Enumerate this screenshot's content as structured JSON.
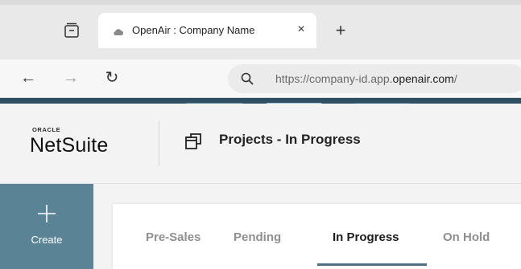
{
  "browser": {
    "tab": {
      "title": "OpenAir : Company Name",
      "close_glyph": "×",
      "favicon": "cloud-icon"
    },
    "new_tab_glyph": "+",
    "nav": {
      "back_glyph": "←",
      "forward_glyph": "→",
      "reload_glyph": "↻"
    },
    "url": {
      "prefix": "https://company-id.app.",
      "domain": "openair.com",
      "suffix": "/"
    }
  },
  "app": {
    "brand": {
      "oracle": "ORACLE",
      "name": "NetSuite"
    },
    "page_title": "Projects - In Progress",
    "create_label": "Create",
    "status_tabs": [
      {
        "label": "Pre-Sales",
        "active": false
      },
      {
        "label": "Pending",
        "active": false
      },
      {
        "label": "In Progress",
        "active": true
      },
      {
        "label": "On Hold",
        "active": false
      }
    ]
  },
  "colors": {
    "accent": "#5b8396",
    "banner": "#2d4e63",
    "active_underline": "#4c7182"
  }
}
